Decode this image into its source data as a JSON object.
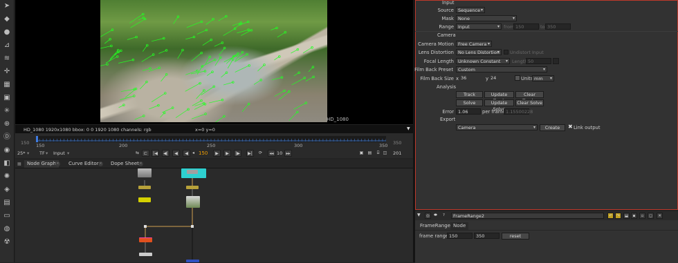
{
  "toolbar": {
    "icons": [
      "pointer-icon",
      "paint-icon",
      "circle-icon",
      "transform-icon",
      "layers-icon",
      "merge-icon",
      "channel-icon",
      "filter-icon",
      "keyer-icon",
      "time-icon",
      "deep-icon",
      "view-icon",
      "3d-icon",
      "particles-icon",
      "tag-icon",
      "toolsets-icon",
      "metadata-icon",
      "other-icon",
      "nuke-icon"
    ]
  },
  "viewer": {
    "format_label": "HD_1080",
    "info_format": "HD_1080 1920x1080  bbox: 0 0 1920 1080 channels: rgb",
    "info_coords": "x=0 y=0"
  },
  "timeline": {
    "range_start": "150",
    "range_end": "350",
    "ticks": [
      "150",
      "200",
      "250",
      "300",
      "350"
    ],
    "current_frame": 150
  },
  "transport": {
    "fps": "25*",
    "tf": "TF",
    "input": "Input",
    "current_frame": "150",
    "increment": "10",
    "end_frame": "201"
  },
  "node_graph": {
    "tabs": [
      "Node Graph",
      "Curve Editor",
      "Dope Sheet"
    ]
  },
  "properties": {
    "input_section": "Input",
    "source_label": "Source",
    "source_value": "Sequence",
    "mask_label": "Mask",
    "mask_value": "None",
    "range_label": "Range",
    "range_value": "Input",
    "range_from_label": "from",
    "range_from": "150",
    "range_to_label": "to",
    "range_to": "350",
    "camera_section": "Camera",
    "camera_motion_label": "Camera Motion",
    "camera_motion_value": "Free Camera",
    "lens_distortion_label": "Lens Distortion",
    "lens_distortion_value": "No Lens Distortion",
    "undistort_label": "Undistort Input",
    "focal_length_label": "Focal Length",
    "focal_length_value": "Unknown Constant",
    "length_label": "Length",
    "length_value": "50",
    "film_back_preset_label": "Film Back Preset",
    "film_back_preset_value": "Custom",
    "film_back_size_label": "Film Back Size",
    "fb_x_label": "x",
    "fb_x": "36",
    "fb_y_label": "y",
    "fb_y": "24",
    "units_label": "Units",
    "units_value": "mm",
    "analysis_section": "Analysis",
    "track_button": "Track",
    "update_track_button": "Update Track",
    "clear_tracks_button": "Clear Tracks",
    "solve_button": "Solve",
    "update_solve_button": "Update Solve",
    "clear_solve_button": "Clear Solve",
    "error_label": "Error",
    "error_value": "1.06",
    "per_frame_label": "per frame",
    "per_frame_value": "1.15500228",
    "export_section": "Export",
    "export_value": "Camera",
    "create_button": "Create",
    "link_output_label": "Link output"
  },
  "frame_range_panel": {
    "node_name": "FrameRange2",
    "tabs": [
      "FrameRange",
      "Node"
    ],
    "frame_range_label": "frame range",
    "frame_start": "150",
    "frame_end": "350",
    "reset_button": "reset"
  }
}
